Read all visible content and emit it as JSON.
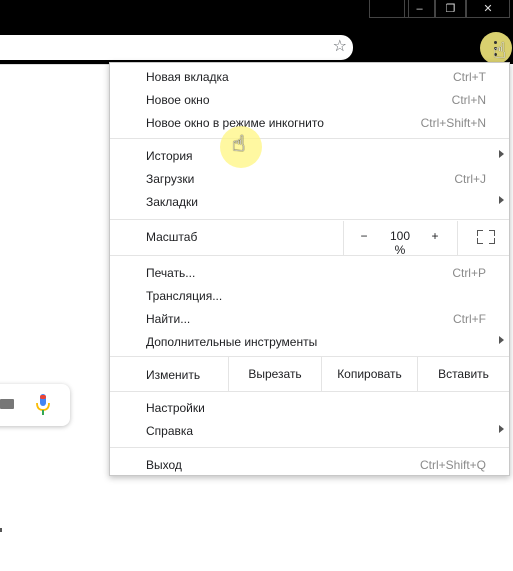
{
  "menu": {
    "new_tab": {
      "label": "Новая вкладка",
      "shortcut": "Ctrl+T"
    },
    "new_window": {
      "label": "Новое окно",
      "shortcut": "Ctrl+N"
    },
    "incognito": {
      "label": "Новое окно в режиме инкогнито",
      "shortcut": "Ctrl+Shift+N"
    },
    "history": {
      "label": "История"
    },
    "downloads": {
      "label": "Загрузки",
      "shortcut": "Ctrl+J"
    },
    "bookmarks": {
      "label": "Закладки"
    },
    "zoom": {
      "label": "Масштаб",
      "minus": "−",
      "value": "100 %",
      "plus": "+"
    },
    "print": {
      "label": "Печать...",
      "shortcut": "Ctrl+P"
    },
    "cast": {
      "label": "Трансляция..."
    },
    "find": {
      "label": "Найти...",
      "shortcut": "Ctrl+F"
    },
    "more_tools": {
      "label": "Дополнительные инструменты"
    },
    "edit": {
      "label": "Изменить",
      "cut": "Вырезать",
      "copy": "Копировать",
      "paste": "Вставить"
    },
    "settings": {
      "label": "Настройки"
    },
    "help": {
      "label": "Справка"
    },
    "exit": {
      "label": "Выход",
      "shortcut": "Ctrl+Shift+Q"
    }
  },
  "window_controls": {
    "minimize": "–",
    "restore": "❐",
    "close": "✕"
  },
  "toolbar": {
    "star_icon": "☆"
  },
  "icons": {
    "cursor": "hand-pointer"
  },
  "colors": {
    "highlight": "#fff582",
    "mic_blue": "#4285f4",
    "mic_red": "#ea4335"
  }
}
